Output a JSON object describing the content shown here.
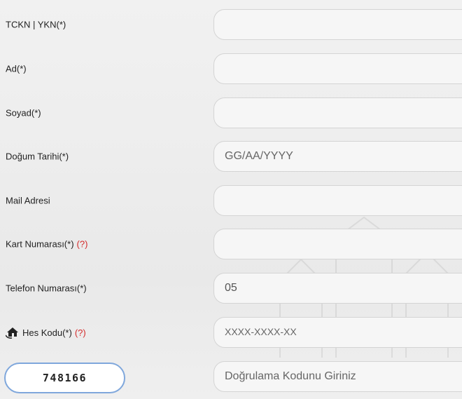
{
  "form": {
    "tckn_label": "TCKN | YKN(*)",
    "tckn_value": "",
    "ad_label": "Ad(*)",
    "ad_value": "",
    "soyad_label": "Soyad(*)",
    "soyad_value": "",
    "dogum_label": "Doğum Tarihi(*)",
    "dogum_placeholder": "GG/AA/YYYY",
    "mail_label": "Mail Adresi",
    "mail_value": "",
    "kart_label": "Kart Numarası(*)",
    "kart_help": "(?)",
    "kart_value": "",
    "telefon_label": "Telefon Numarası(*)",
    "telefon_value": "05",
    "hes_label": "Hes Kodu(*)",
    "hes_help": "(?)",
    "hes_placeholder": "XXXX-XXXX-XX",
    "captcha_code": "748166",
    "captcha_placeholder": "Doğrulama Kodunu Giriniz"
  },
  "icons": {
    "hes": "house-hands-icon",
    "help": "question-mark"
  },
  "colors": {
    "help": "#d42b2b",
    "captcha_border": "#7fa7dc",
    "field_border": "#d4d4d4"
  }
}
